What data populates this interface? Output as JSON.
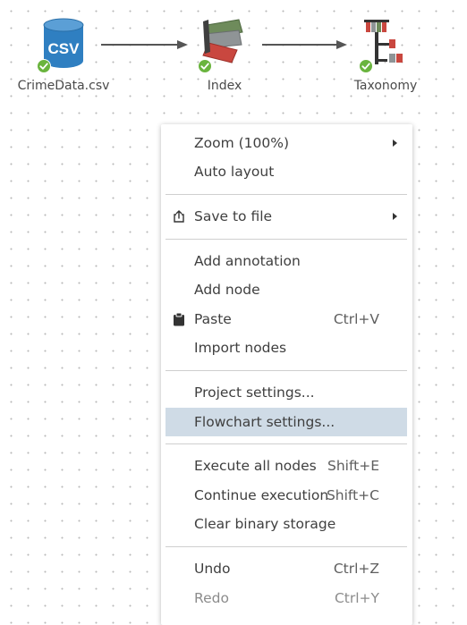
{
  "nodes": [
    {
      "label": "CrimeData.csv",
      "icon": "csv-file-icon",
      "status": "ok"
    },
    {
      "label": "Index",
      "icon": "index-icon",
      "status": "ok"
    },
    {
      "label": "Taxonomy",
      "icon": "taxonomy-icon",
      "status": "ok"
    }
  ],
  "csv_icon_text": "CSV",
  "colors": {
    "status_ok": "#6ab43e",
    "menu_highlight": "#cfdbe6",
    "csv_blue": "#2f7fc1"
  },
  "menu": {
    "zoom": {
      "label": "Zoom (100%)"
    },
    "auto_layout": {
      "label": "Auto layout"
    },
    "save_to_file": {
      "label": "Save to file"
    },
    "add_annotation": {
      "label": "Add annotation"
    },
    "add_node": {
      "label": "Add node"
    },
    "paste": {
      "label": "Paste",
      "shortcut": "Ctrl+V"
    },
    "import_nodes": {
      "label": "Import nodes"
    },
    "project_settings": {
      "label": "Project settings..."
    },
    "flowchart_settings": {
      "label": "Flowchart settings..."
    },
    "execute_all": {
      "label": "Execute all nodes",
      "shortcut": "Shift+E"
    },
    "continue_execution": {
      "label": "Continue execution",
      "shortcut": "Shift+C"
    },
    "clear_binary": {
      "label": "Clear binary storage"
    },
    "undo": {
      "label": "Undo",
      "shortcut": "Ctrl+Z"
    },
    "redo": {
      "label": "Redo",
      "shortcut": "Ctrl+Y"
    }
  }
}
